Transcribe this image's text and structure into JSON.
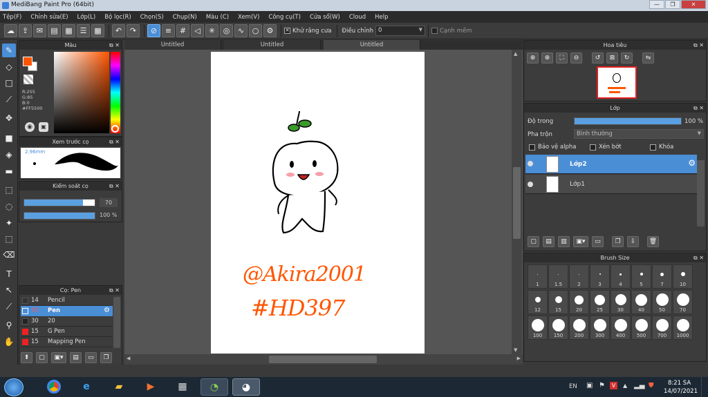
{
  "window": {
    "title": "MediBang Paint Pro (64bit)"
  },
  "menu": [
    "Tệp(F)",
    "Chỉnh sửa(E)",
    "Lớp(L)",
    "Bộ lọc(R)",
    "Chọn(S)",
    "Chụp(N)",
    "Màu (C)",
    "Xem(V)",
    "Công cụ(T)",
    "Cửa sổ(W)",
    "Cloud",
    "Help"
  ],
  "toolbar": {
    "antialias_label": "Khử răng cưa",
    "adjust_label": "Điều chỉnh",
    "adjust_value": "0",
    "edge_label": "Cạnh mềm"
  },
  "color_panel": {
    "title": "Màu",
    "r": "R:255",
    "g": "G:85",
    "b": "B:0",
    "hex": "#FF5500",
    "fg_color": "#FF5500"
  },
  "brush_preview": {
    "title": "Xem trước cọ",
    "size": "2.96mm"
  },
  "brush_control": {
    "title": "Kiểm soát cọ",
    "size_value": "70",
    "opacity_value": "100 %"
  },
  "brush_list": {
    "title": "Cọ: Pen",
    "items": [
      {
        "size": "14",
        "name": "Pencil",
        "color": "#333333"
      },
      {
        "size": "70",
        "name": "Pen",
        "color": "#4a8ed6"
      },
      {
        "size": "30",
        "name": "20",
        "color": "#222222"
      },
      {
        "size": "15",
        "name": "G Pen",
        "color": "#ee2222"
      },
      {
        "size": "15",
        "name": "Mapping Pen",
        "color": "#ee2222"
      }
    ]
  },
  "tabs": [
    "Untitled",
    "Untitled",
    "Untitled"
  ],
  "canvas": {
    "handle": "@Akira2001",
    "tag": "#HD397"
  },
  "navigator": {
    "title": "Hoa tiêu"
  },
  "layers": {
    "title": "Lớp",
    "opacity_label": "Độ trong",
    "opacity_value": "100 %",
    "blend_label": "Pha trộn",
    "blend_value": "Bình thường",
    "protect_alpha": "Bảo vệ alpha",
    "clip": "Xén bớt",
    "lock": "Khóa",
    "items": [
      {
        "name": "Lớp2"
      },
      {
        "name": "Lớp1"
      }
    ]
  },
  "brush_size": {
    "title": "Brush Size",
    "sizes": [
      "1",
      "1.5",
      "2",
      "3",
      "4",
      "5",
      "7",
      "10",
      "12",
      "15",
      "20",
      "25",
      "30",
      "40",
      "50",
      "70",
      "100",
      "150",
      "200",
      "300",
      "400",
      "500",
      "700",
      "1000"
    ]
  },
  "taskbar": {
    "lang": "EN",
    "time": "8:21 SA",
    "date": "14/07/2021"
  }
}
